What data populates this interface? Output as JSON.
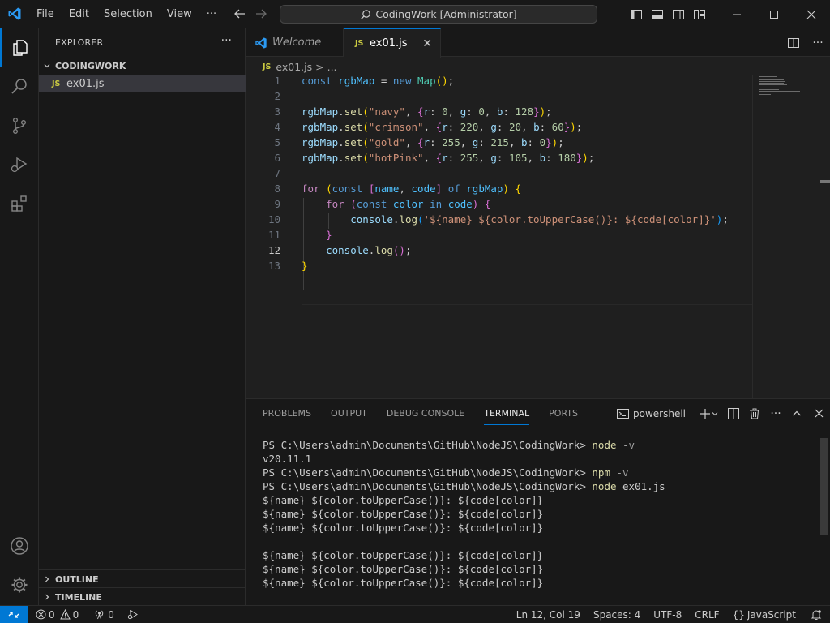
{
  "titlebar": {
    "menu": [
      "File",
      "Edit",
      "Selection",
      "View"
    ],
    "more": "···",
    "command_center": "CodingWork [Administrator]"
  },
  "sidebar": {
    "title": "EXPLORER",
    "more": "···",
    "folder": "CODINGWORK",
    "files": [
      {
        "icon": "JS",
        "name": "ex01.js"
      }
    ],
    "outline": "OUTLINE",
    "timeline": "TIMELINE"
  },
  "editor": {
    "tabs": [
      {
        "label": "Welcome",
        "icon": "vscode-icon"
      },
      {
        "label": "ex01.js",
        "icon": "JS",
        "close": "✕"
      }
    ],
    "breadcrumb": {
      "icon": "JS",
      "file": "ex01.js",
      "sep": ">",
      "more": "..."
    },
    "line_numbers": [
      "1",
      "2",
      "3",
      "4",
      "5",
      "6",
      "7",
      "8",
      "9",
      "10",
      "11",
      "12",
      "13"
    ],
    "current_line": "12"
  },
  "panel": {
    "tabs": [
      "PROBLEMS",
      "OUTPUT",
      "DEBUG CONSOLE",
      "TERMINAL",
      "PORTS"
    ],
    "active_tab": "TERMINAL",
    "shell": "powershell",
    "more": "···",
    "terminal": {
      "prompt": "PS C:\\Users\\admin\\Documents\\GitHub\\NodeJS\\CodingWork>",
      "cmd1": "node",
      "arg1": "-v",
      "out1": "v20.11.1",
      "cmd2": "npm",
      "arg2": "-v",
      "cmd3": "node",
      "arg3": "ex01.js",
      "output_line": "${name} ${color.toUpperCase()}: ${code[color]}"
    }
  },
  "statusbar": {
    "errors": "0",
    "warnings": "0",
    "ports": "0",
    "position": "Ln 12, Col 19",
    "spaces": "Spaces: 4",
    "encoding": "UTF-8",
    "eol": "CRLF",
    "language_icon": "{}",
    "language": "JavaScript"
  },
  "colors": {
    "accent": "#0078d4",
    "background": "#1f1f1f",
    "sidebar": "#181818",
    "js_icon": "#cbcb41"
  }
}
